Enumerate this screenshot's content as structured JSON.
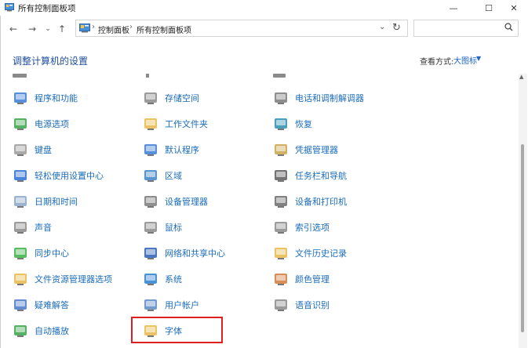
{
  "window": {
    "title": "所有控制面板项",
    "minimize": "—",
    "maximize": "☐",
    "close": "✕"
  },
  "nav": {
    "back": "←",
    "forward": "→",
    "history": "⌄",
    "up": "↑",
    "refresh": "↻"
  },
  "address": {
    "crumbs": [
      "控制面板",
      "所有控制面板项"
    ],
    "separator": "›",
    "dropdown": "⌄"
  },
  "search": {
    "placeholder": "",
    "icon": "search-icon"
  },
  "header": {
    "title": "调整计算机的设置",
    "view_label": "查看方式:",
    "view_value": "大图标",
    "view_arrow": "▼"
  },
  "columns": [
    [
      {
        "label": "程序和功能",
        "icon": "programs-icon",
        "color": "#3a7bd5"
      },
      {
        "label": "电源选项",
        "icon": "power-icon",
        "color": "#3aa34a"
      },
      {
        "label": "键盘",
        "icon": "keyboard-icon",
        "color": "#9a9a9a"
      },
      {
        "label": "轻松使用设置中心",
        "icon": "ease-of-access-icon",
        "color": "#2a6fd6"
      },
      {
        "label": "日期和时间",
        "icon": "clock-icon",
        "color": "#8aa6c8"
      },
      {
        "label": "声音",
        "icon": "speaker-icon",
        "color": "#8a8a8a"
      },
      {
        "label": "同步中心",
        "icon": "sync-icon",
        "color": "#3cb043"
      },
      {
        "label": "文件资源管理器选项",
        "icon": "folder-options-icon",
        "color": "#e8b84a"
      },
      {
        "label": "疑难解答",
        "icon": "troubleshoot-icon",
        "color": "#4a78c9"
      },
      {
        "label": "自动播放",
        "icon": "autoplay-icon",
        "color": "#3aa34a"
      }
    ],
    [
      {
        "label": "存储空间",
        "icon": "storage-icon",
        "color": "#8a8a8a"
      },
      {
        "label": "工作文件夹",
        "icon": "work-folders-icon",
        "color": "#e8b84a"
      },
      {
        "label": "默认程序",
        "icon": "default-programs-icon",
        "color": "#3a7bd5"
      },
      {
        "label": "区域",
        "icon": "region-icon",
        "color": "#3a84c9"
      },
      {
        "label": "设备管理器",
        "icon": "device-manager-icon",
        "color": "#7a7a7a"
      },
      {
        "label": "鼠标",
        "icon": "mouse-icon",
        "color": "#8a8a8a"
      },
      {
        "label": "网络和共享中心",
        "icon": "network-icon",
        "color": "#2a5fb5"
      },
      {
        "label": "系统",
        "icon": "system-icon",
        "color": "#2a7fd0"
      },
      {
        "label": "用户帐户",
        "icon": "user-accounts-icon",
        "color": "#5a8ac8"
      },
      {
        "label": "字体",
        "icon": "fonts-icon",
        "color": "#e8b84a"
      }
    ],
    [
      {
        "label": "电话和调制解调器",
        "icon": "phone-modem-icon",
        "color": "#7a7a7a"
      },
      {
        "label": "恢复",
        "icon": "recovery-icon",
        "color": "#2a8fb0"
      },
      {
        "label": "凭据管理器",
        "icon": "credential-icon",
        "color": "#c9a34a"
      },
      {
        "label": "任务栏和导航",
        "icon": "taskbar-icon",
        "color": "#5a5a5a"
      },
      {
        "label": "设备和打印机",
        "icon": "printer-icon",
        "color": "#6a6a6a"
      },
      {
        "label": "索引选项",
        "icon": "indexing-icon",
        "color": "#8a8a8a"
      },
      {
        "label": "文件历史记录",
        "icon": "file-history-icon",
        "color": "#e8b84a"
      },
      {
        "label": "颜色管理",
        "icon": "color-management-icon",
        "color": "#d07a3a"
      },
      {
        "label": "语音识别",
        "icon": "microphone-icon",
        "color": "#8a8a8a"
      }
    ]
  ]
}
